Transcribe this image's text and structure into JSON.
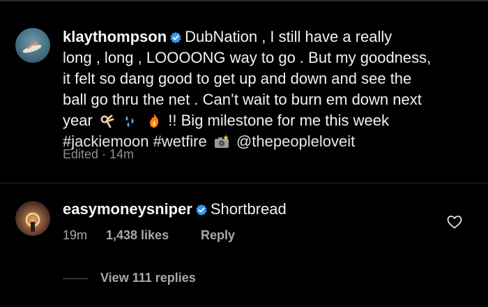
{
  "post": {
    "author": {
      "username": "klaythompson",
      "verified": true,
      "avatar_icon": "avatar-surfer-icon"
    },
    "caption_lines": [
      "DubNation , I still have a really",
      "long , long , LOOOONG way to go . But my goodness,",
      "it felt so dang good to get up and down and see the",
      "ball go thru the net . Can’t wait to burn em down next",
      "year",
      "!! Big milestone for me this week"
    ],
    "emojis": [
      "ok-hand-emoji",
      "splash-emoji",
      "fire-emoji",
      "camera-flash-emoji"
    ],
    "hashtags": [
      "#jackiemoon",
      "#wetfire"
    ],
    "mention": "@thepeopleloveit",
    "meta": "Edited · 14m"
  },
  "comment": {
    "author": {
      "username": "easymoneysniper",
      "verified": true,
      "avatar_icon": "avatar-sunset-icon"
    },
    "text": "Shortbread",
    "time": "19m",
    "likes": "1,438 likes",
    "reply_label": "Reply",
    "view_replies": "View 111 replies",
    "like_icon": "heart-outline-icon"
  },
  "colors": {
    "background": "#000000",
    "text_primary": "#f2f2f2",
    "text_secondary": "#8e8e8e",
    "verified_blue": "#3897f0"
  }
}
